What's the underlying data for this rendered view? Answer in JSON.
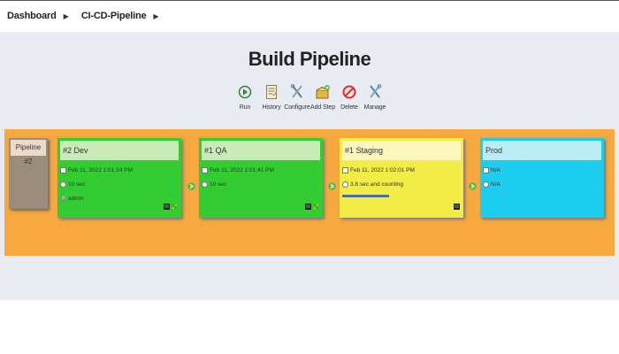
{
  "breadcrumb": {
    "items": [
      "Dashboard",
      "CI-CD-Pipeline"
    ]
  },
  "page": {
    "title": "Build Pipeline"
  },
  "toolbar": {
    "run": "Run",
    "history": "History",
    "configure": "Configure",
    "add_step": "Add Step",
    "delete": "Delete",
    "manage": "Manage"
  },
  "pipeline": {
    "label": "Pipeline",
    "number": "#2",
    "stages": [
      {
        "name": "#2 Dev",
        "date": "Feb 11, 2022 1:01:24 PM",
        "duration": "10 sec",
        "user": "admin",
        "status": "success"
      },
      {
        "name": "#1 QA",
        "date": "Feb 11, 2022 1:01:41 PM",
        "duration": "10 sec",
        "status": "success"
      },
      {
        "name": "#1 Staging",
        "date": "Feb 11, 2022 1:02:01 PM",
        "duration": "3.8 sec and counting",
        "status": "running",
        "progress": 0.55
      },
      {
        "name": "Prod",
        "date": "N/A",
        "duration": "N/A",
        "status": "pending"
      }
    ]
  },
  "colors": {
    "success": "#33cc33",
    "success_header": "#c8ecb8",
    "running": "#f2ec46",
    "running_header": "#fbf6bc",
    "pending": "#1dcdef",
    "pending_header": "#b9ecf4",
    "band": "#f7a83e"
  }
}
